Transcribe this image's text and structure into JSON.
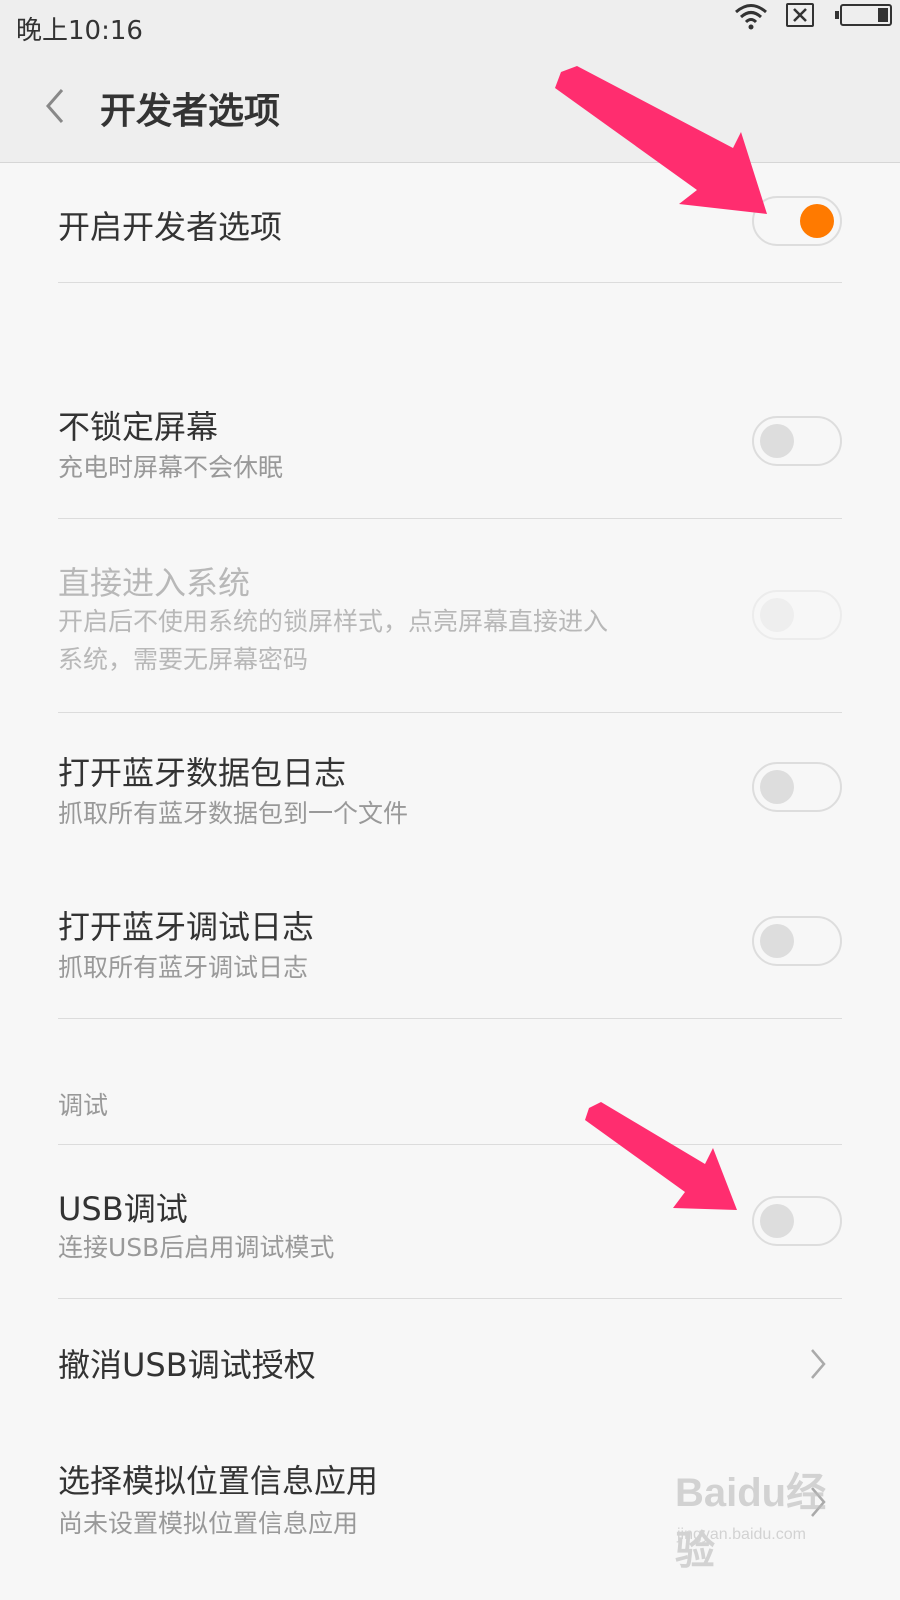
{
  "status_bar": {
    "time": "晚上10:16"
  },
  "header": {
    "title": "开发者选项"
  },
  "settings": [
    {
      "title": "开启开发者选项",
      "toggle": "on"
    },
    {
      "title": "不锁定屏幕",
      "subtitle": "充电时屏幕不会休眠",
      "toggle": "off"
    },
    {
      "title": "直接进入系统",
      "subtitle_lines": [
        "开启后不使用系统的锁屏样式，点亮屏幕直接进入",
        "系统，需要无屏幕密码"
      ],
      "toggle": "off",
      "disabled": true
    },
    {
      "title": "打开蓝牙数据包日志",
      "subtitle": "抓取所有蓝牙数据包到一个文件",
      "toggle": "off"
    },
    {
      "title": "打开蓝牙调试日志",
      "subtitle": "抓取所有蓝牙调试日志",
      "toggle": "off"
    },
    {
      "title": "USB调试",
      "subtitle": "连接USB后启用调试模式",
      "toggle": "off"
    },
    {
      "title": "撤消USB调试授权"
    },
    {
      "title": "选择模拟位置信息应用",
      "subtitle": "尚未设置模拟位置信息应用"
    }
  ],
  "section_debug": "调试",
  "watermark": {
    "logo": "Baidu经验",
    "url": "jingyan.baidu.com"
  },
  "colors": {
    "accent": "#ff7a00",
    "arrow": "#ff2d6f",
    "background": "#f7f7f7"
  },
  "icons": [
    "wifi-icon",
    "no-sim-icon",
    "battery-icon",
    "back-arrow-icon",
    "chevron-right-icon"
  ]
}
